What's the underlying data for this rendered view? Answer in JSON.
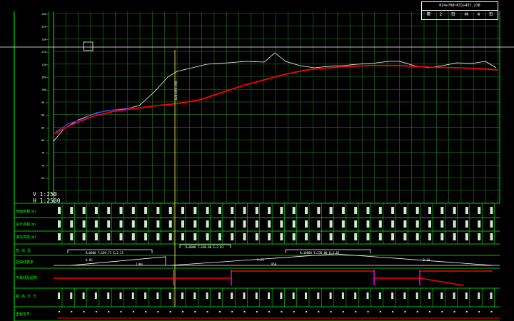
{
  "drawing": {
    "title_block": {
      "code": "K24+700~K31+437.238",
      "sheet_label": "第",
      "sheet_no": "2",
      "sheet_unit": "页",
      "total_label": "共",
      "total_no": "4",
      "total_unit": "页"
    },
    "scale": {
      "v": "V 1:250",
      "h": "H 1:2500"
    },
    "y_ticks": [
      "130",
      "125",
      "120",
      "115",
      "110",
      "105",
      "100",
      "95",
      "90",
      "85",
      "80",
      "75",
      "70",
      "65"
    ],
    "band_labels": [
      "地面高程(m)",
      "设计高程(m)",
      "填挖高度(m)",
      "直 线 及",
      "竖曲线要素",
      "平曲线及超高",
      "超 高 方 式",
      "里程桩号",
      "桩 号"
    ],
    "vert_curve_label": "R=8000 T=189.75 E=2.25",
    "vert_curve_label_2": "R=8000 T=180.00 E=2.03",
    "vert_curve_label_3": "R=10000 T=238.00 E=2.83",
    "grade_1": "0.85",
    "grade_2": "3.25",
    "grade_3": "-0.34",
    "grade_len_1": "1200",
    "grade_len_2": "950",
    "station_text": "K28+350.000"
  },
  "colors": {
    "grid": "#1f7a1f",
    "bright": "#00ff00",
    "ground": "#ffffff",
    "design": "#ff0000",
    "highlight": "#3333ff",
    "cursor": "#ffff66",
    "superelev": "#ff00ff"
  }
}
